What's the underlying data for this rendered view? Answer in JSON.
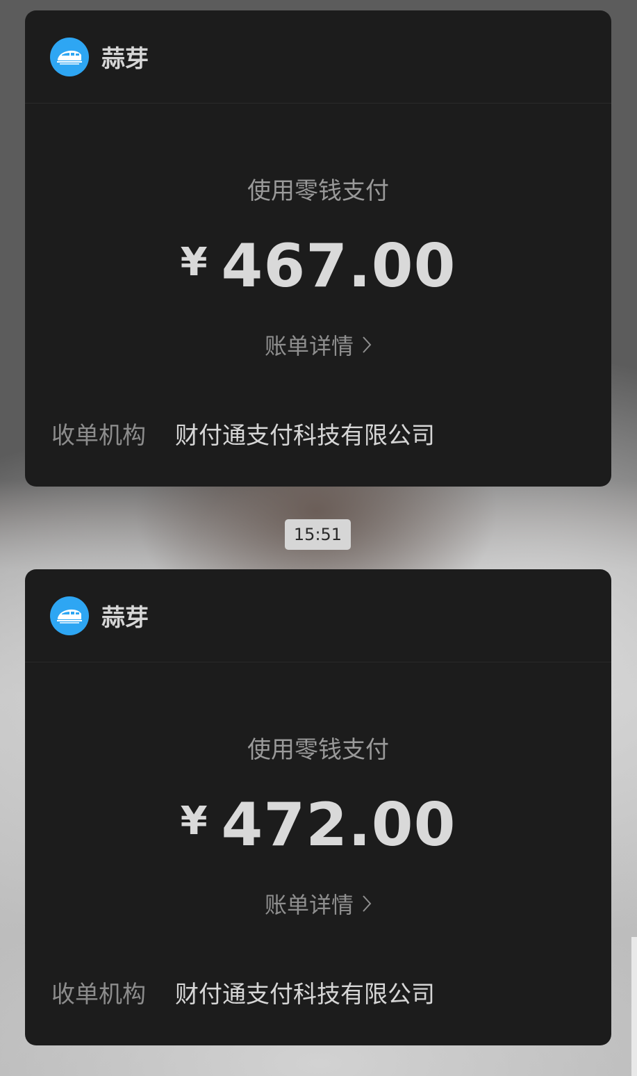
{
  "messages": [
    {
      "app_name": "蒜芽",
      "app_icon": "train-icon",
      "pay_method": "使用零钱支付",
      "currency": "¥",
      "amount": "467.00",
      "detail_link": "账单详情",
      "merchant_label": "收单机构",
      "merchant_value": "财付通支付科技有限公司"
    },
    {
      "app_name": "蒜芽",
      "app_icon": "train-icon",
      "pay_method": "使用零钱支付",
      "currency": "¥",
      "amount": "472.00",
      "detail_link": "账单详情",
      "merchant_label": "收单机构",
      "merchant_value": "财付通支付科技有限公司"
    }
  ],
  "timestamp": "15:51",
  "colors": {
    "card_bg": "#1c1c1c",
    "icon_blue": "#2ea6f3",
    "timestamp_bg": "#d6d6d6"
  }
}
